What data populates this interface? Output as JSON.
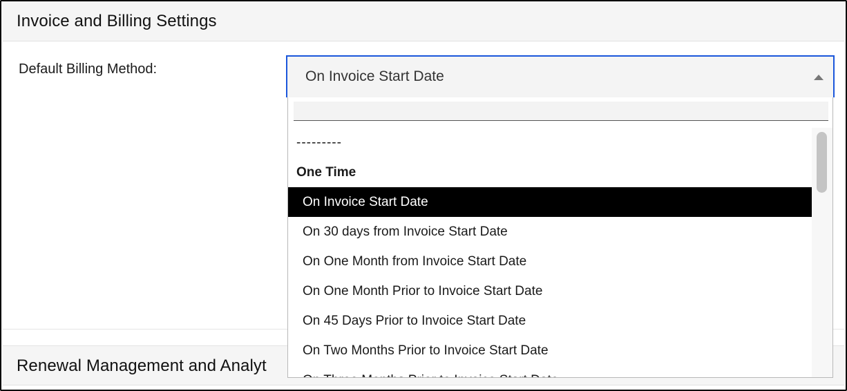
{
  "sections": {
    "invoice_title": "Invoice and Billing Settings",
    "renewal_title": "Renewal Management and Analyt"
  },
  "billing": {
    "label": "Default Billing Method:",
    "selected_value": "On Invoice Start Date",
    "search_placeholder": "",
    "options": [
      "---------",
      "One Time",
      "On Invoice Start Date",
      "On 30 days from Invoice Start Date",
      "On One Month from Invoice Start Date",
      "On One Month Prior to Invoice Start Date",
      "On 45 Days Prior to Invoice Start Date",
      "On Two Months Prior to Invoice Start Date",
      "On Three Months Prior to Invoice Start Date"
    ]
  },
  "icons": {
    "dropdown_arrow": "caret-up-icon"
  },
  "colors": {
    "focus_border": "#1a56db",
    "selected_bg": "#000000",
    "selected_fg": "#ffffff"
  }
}
